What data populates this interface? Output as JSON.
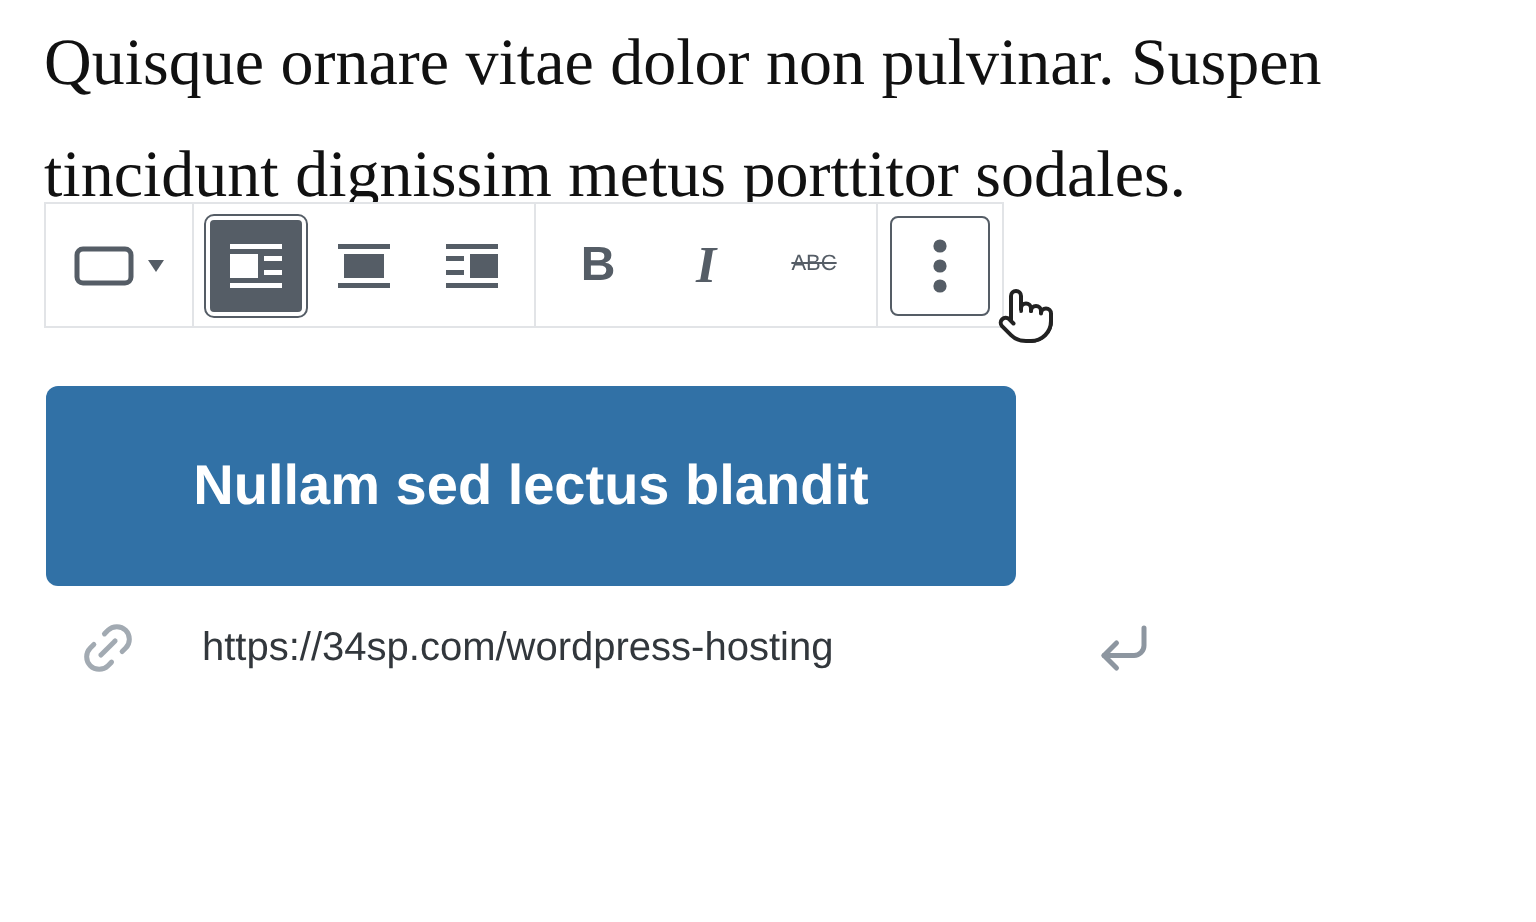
{
  "paragraph": {
    "lines": [
      "Quisque ornare vitae dolor non pulvinar. Suspen",
      "tincidunt dignissim metus porttitor sodales."
    ]
  },
  "toolbar": {
    "groups": [
      {
        "buttons": [
          {
            "kind": "block-style",
            "selected": false
          }
        ]
      },
      {
        "buttons": [
          {
            "kind": "align-left",
            "selected": true
          },
          {
            "kind": "align-center",
            "selected": false
          },
          {
            "kind": "align-right",
            "selected": false
          }
        ]
      },
      {
        "buttons": [
          {
            "kind": "bold",
            "label": "B",
            "selected": false
          },
          {
            "kind": "italic",
            "label": "I",
            "selected": false
          },
          {
            "kind": "strikethrough",
            "label": "ABC",
            "selected": false
          }
        ]
      },
      {
        "buttons": [
          {
            "kind": "more",
            "selected": false,
            "focused": true
          }
        ]
      }
    ]
  },
  "button": {
    "label": "Nullam sed lectus blandit"
  },
  "link": {
    "url": "https://34sp.com/wordpress-hosting"
  }
}
